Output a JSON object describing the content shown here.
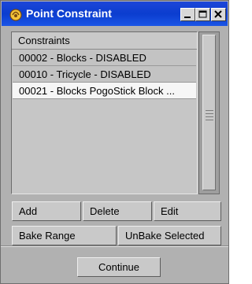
{
  "window": {
    "title": "Point Constraint",
    "controls": {
      "minimize": "minimize",
      "maximize": "maximize",
      "close": "close"
    }
  },
  "list": {
    "header": "Constraints",
    "items": [
      {
        "label": "00002 - Blocks - DISABLED"
      },
      {
        "label": "00010 - Tricycle - DISABLED"
      },
      {
        "label": "00021 -  Blocks PogoStick Block ..."
      }
    ]
  },
  "buttons": {
    "add": "Add",
    "delete": "Delete",
    "edit": "Edit",
    "bake_range": "Bake Range",
    "unbake_selected": "UnBake Selected",
    "continue": "Continue"
  },
  "colors": {
    "titlebar": "#0b3dcf",
    "window_bg": "#b1b1b1",
    "selected_row": "#f6f6f6"
  }
}
